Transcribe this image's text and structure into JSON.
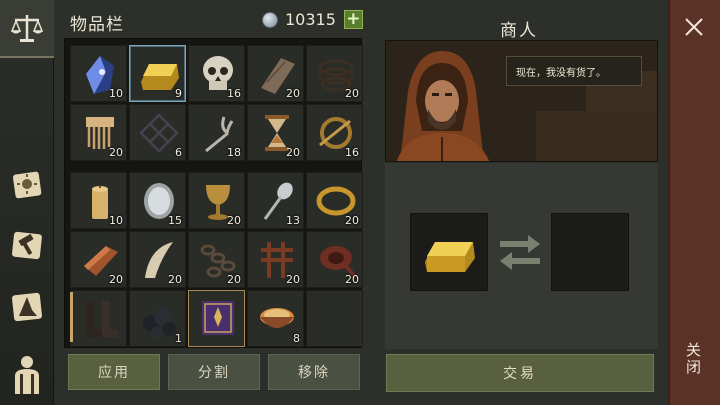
{
  "inventory": {
    "title": "物品栏",
    "currency": "10315",
    "add_label": "+"
  },
  "slots": [
    {
      "name": "crystal-shard",
      "qty": "10"
    },
    {
      "name": "gold-ingot",
      "qty": "9"
    },
    {
      "name": "skull",
      "qty": "16"
    },
    {
      "name": "wood-plank",
      "qty": "20"
    },
    {
      "name": "rope",
      "qty": "20"
    },
    {
      "name": "bone-comb",
      "qty": "20"
    },
    {
      "name": "iron-grate",
      "qty": "6"
    },
    {
      "name": "tuning-fork",
      "qty": "18"
    },
    {
      "name": "hourglass",
      "qty": "20"
    },
    {
      "name": "brooch",
      "qty": "16"
    },
    {
      "name": "candle",
      "qty": "10"
    },
    {
      "name": "silver-mirror",
      "qty": "15"
    },
    {
      "name": "goblet",
      "qty": "20"
    },
    {
      "name": "spoon",
      "qty": "13"
    },
    {
      "name": "gold-ring",
      "qty": "20"
    },
    {
      "name": "copper-ingot",
      "qty": "20"
    },
    {
      "name": "fang",
      "qty": "20"
    },
    {
      "name": "chain",
      "qty": "20"
    },
    {
      "name": "leather-straps",
      "qty": "20"
    },
    {
      "name": "leather-roll",
      "qty": "20"
    },
    {
      "name": "boots",
      "qty": ""
    },
    {
      "name": "coal",
      "qty": "1"
    },
    {
      "name": "spellbook",
      "qty": ""
    },
    {
      "name": "stew-bowl",
      "qty": "8"
    },
    {
      "name": "empty",
      "qty": ""
    }
  ],
  "actions": {
    "apply": "应用",
    "split": "分割",
    "remove": "移除"
  },
  "merchant": {
    "title": "商人",
    "speech": "现在，我没有货了。",
    "trade": "交易"
  },
  "close": {
    "label": "关闭"
  },
  "colors": {
    "accent": "#58603f",
    "close_panel": "#5b3226",
    "currency_plus": "#5a7d2e"
  }
}
